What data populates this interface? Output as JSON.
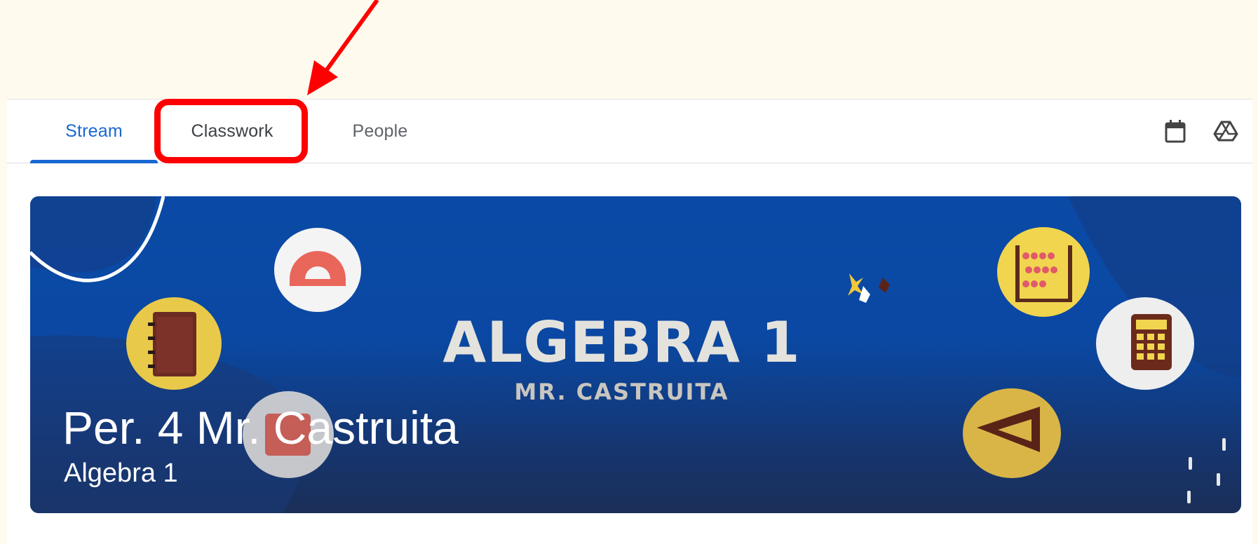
{
  "tabs": [
    {
      "label": "Stream",
      "active": true
    },
    {
      "label": "Classwork",
      "active": false,
      "highlighted": true
    },
    {
      "label": "People",
      "active": false
    }
  ],
  "toolbar": {
    "calendar_icon": "calendar-icon",
    "drive_icon": "google-drive-icon"
  },
  "banner": {
    "art_title": "ALGEBRA 1",
    "art_subtitle": "MR. CASTRUITA",
    "class_name": "Per. 4 Mr. Castruita",
    "section": "Algebra 1"
  },
  "colors": {
    "accent": "#1967d2",
    "highlight": "#ff0000",
    "page_background": "#fffaee",
    "banner_blue": "#0a4aa6"
  }
}
